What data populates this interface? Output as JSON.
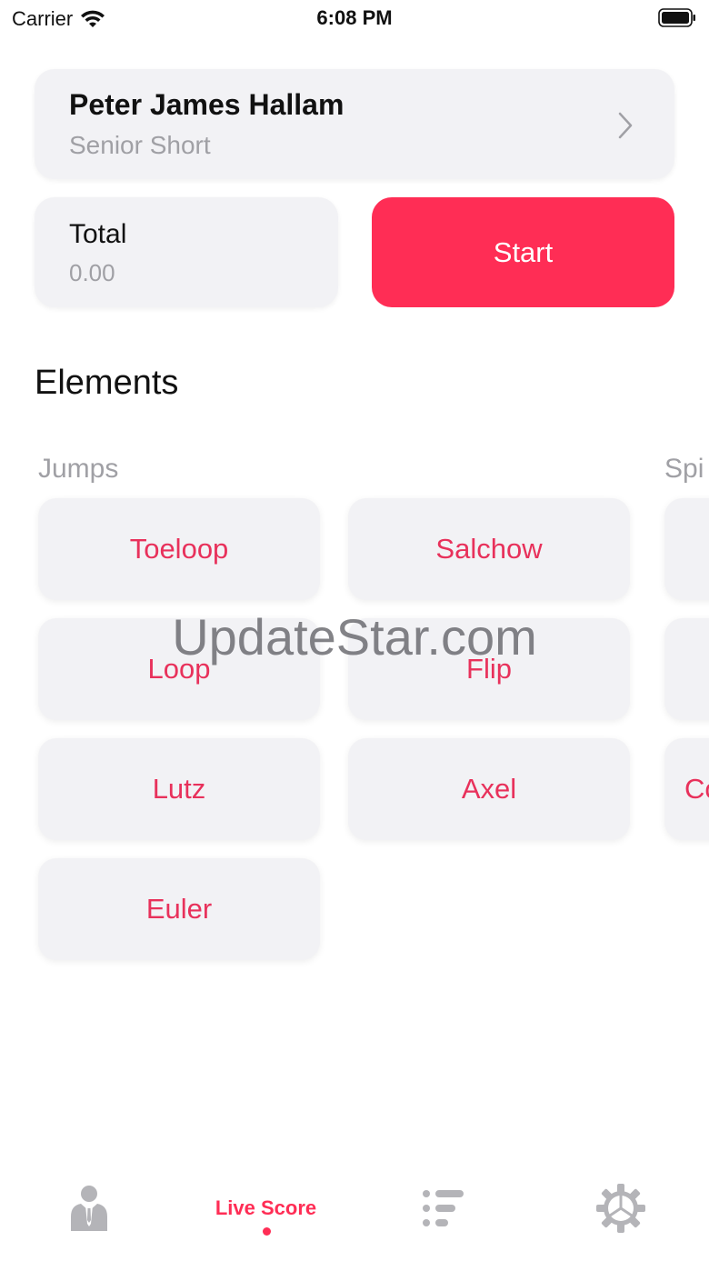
{
  "status_bar": {
    "carrier": "Carrier",
    "time": "6:08 PM"
  },
  "skater": {
    "name": "Peter James Hallam",
    "program": "Senior Short"
  },
  "total": {
    "label": "Total",
    "value": "0.00"
  },
  "start_label": "Start",
  "elements_title": "Elements",
  "groups": [
    {
      "label": "Jumps",
      "items": [
        "Toeloop",
        "Salchow",
        "Loop",
        "Flip",
        "Lutz",
        "Axel",
        "Euler"
      ]
    },
    {
      "label": "Spi",
      "items": [
        "",
        "",
        "Co"
      ]
    }
  ],
  "watermark": "UpdateStar.com",
  "tabs": [
    {
      "icon": "skater-icon",
      "label": ""
    },
    {
      "icon": "",
      "label": "Live Score",
      "active": true
    },
    {
      "icon": "list-icon",
      "label": ""
    },
    {
      "icon": "gear-icon",
      "label": ""
    }
  ],
  "colors": {
    "accent": "#ff2d55",
    "element_text": "#e8315b",
    "card": "#f2f2f5",
    "secondary_text": "#a0a0a5"
  }
}
